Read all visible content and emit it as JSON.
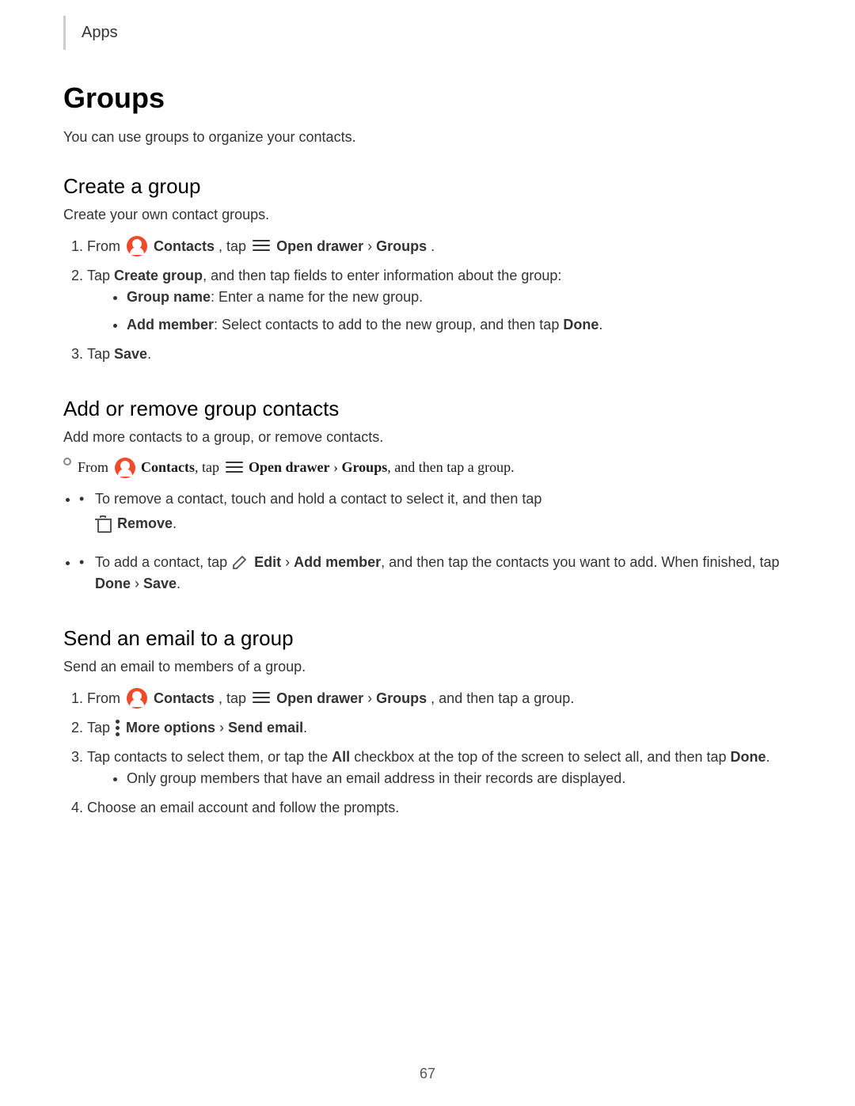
{
  "header": {
    "breadcrumb": "Apps"
  },
  "page": {
    "title": "Groups",
    "intro": "You can use groups to organize your contacts.",
    "sections": [
      {
        "id": "create-a-group",
        "title": "Create a group",
        "desc": "Create your own contact groups.",
        "steps": [
          {
            "num": "1",
            "parts": [
              {
                "type": "text",
                "value": "From "
              },
              {
                "type": "contacts-icon"
              },
              {
                "type": "bold",
                "value": " Contacts"
              },
              {
                "type": "text",
                "value": ", tap "
              },
              {
                "type": "drawer-icon"
              },
              {
                "type": "bold",
                "value": " Open drawer"
              },
              {
                "type": "text",
                "value": " › "
              },
              {
                "type": "bold",
                "value": "Groups"
              },
              {
                "type": "text",
                "value": "."
              }
            ]
          },
          {
            "num": "2",
            "text": "Tap Create group, and then tap fields to enter information about the group:",
            "bullets": [
              "Group name: Enter a name for the new group.",
              "Add member: Select contacts to add to the new group, and then tap Done."
            ]
          },
          {
            "num": "3",
            "text": "Tap Save."
          }
        ]
      },
      {
        "id": "add-remove",
        "title": "Add or remove group contacts",
        "desc": "Add more contacts to a group, or remove contacts.",
        "circle_step": {
          "parts": [
            {
              "type": "text",
              "value": "From "
            },
            {
              "type": "contacts-icon"
            },
            {
              "type": "bold",
              "value": " Contacts"
            },
            {
              "type": "text",
              "value": ", tap "
            },
            {
              "type": "drawer-icon"
            },
            {
              "type": "bold",
              "value": " Open drawer"
            },
            {
              "type": "text",
              "value": " › "
            },
            {
              "type": "bold",
              "value": "Groups"
            },
            {
              "type": "text",
              "value": ", and then tap a group."
            }
          ]
        },
        "bullets": [
          {
            "type": "remove",
            "text": "To remove a contact, touch and hold a contact to select it, and then tap Remove."
          },
          {
            "type": "edit",
            "text": "To add a contact, tap Edit › Add member, and then tap the contacts you want to add. When finished, tap Done › Save."
          }
        ]
      },
      {
        "id": "send-email",
        "title": "Send an email to a group",
        "desc": "Send an email to members of a group.",
        "steps": [
          {
            "num": "1",
            "parts": [
              {
                "type": "text",
                "value": "From "
              },
              {
                "type": "contacts-icon"
              },
              {
                "type": "bold",
                "value": " Contacts"
              },
              {
                "type": "text",
                "value": ", tap "
              },
              {
                "type": "drawer-icon"
              },
              {
                "type": "bold",
                "value": " Open drawer"
              },
              {
                "type": "text",
                "value": " › "
              },
              {
                "type": "bold",
                "value": "Groups"
              },
              {
                "type": "text",
                "value": ", and then tap a group."
              }
            ]
          },
          {
            "num": "2",
            "text": "Tap More options › Send email."
          },
          {
            "num": "3",
            "text": "Tap contacts to select them, or tap the All checkbox at the top of the screen to select all, and then tap Done.",
            "bullets": [
              "Only group members that have an email address in their records are displayed."
            ]
          },
          {
            "num": "4",
            "text": "Choose an email account and follow the prompts."
          }
        ]
      }
    ],
    "footer_page": "67"
  }
}
